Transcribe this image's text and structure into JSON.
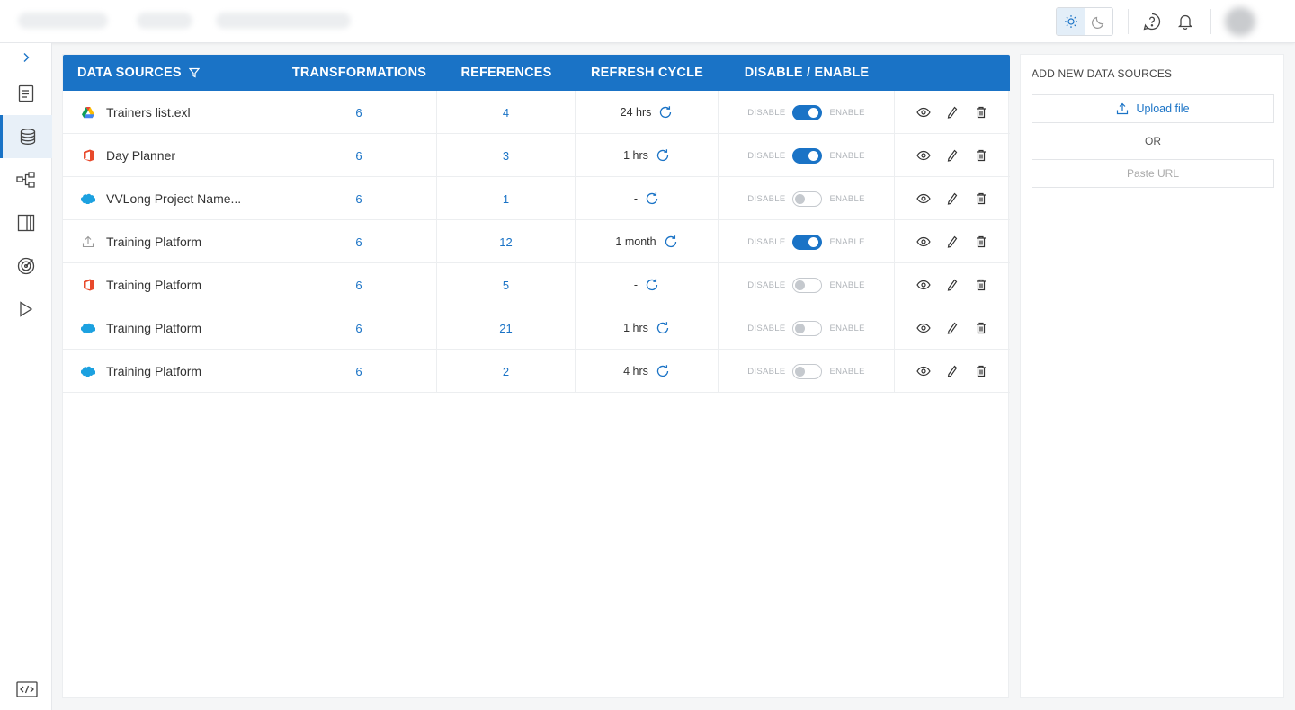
{
  "theme": {
    "accent": "#1a73c6"
  },
  "header": {
    "theme_modes": [
      "light-mode",
      "dark-mode"
    ],
    "active_theme": "light-mode"
  },
  "sidebar": {
    "items": [
      {
        "icon": "document-icon",
        "active": false
      },
      {
        "icon": "database-icon",
        "active": true
      },
      {
        "icon": "workflow-icon",
        "active": false
      },
      {
        "icon": "columns-icon",
        "active": false
      },
      {
        "icon": "target-icon",
        "active": false
      },
      {
        "icon": "play-icon",
        "active": false
      }
    ],
    "bottom_icon": "code-icon"
  },
  "table": {
    "headers": [
      "DATA SOURCES",
      "TRANSFORMATIONS",
      "REFERENCES",
      "REFRESH CYCLE",
      "DISABLE / ENABLE"
    ],
    "toggle_labels": {
      "off": "DISABLE",
      "on": "ENABLE"
    },
    "rows": [
      {
        "source_icon": "google-drive-icon",
        "name": "Trainers list.exl",
        "transformations": "6",
        "references": "4",
        "refresh_cycle": "24 hrs",
        "enabled": true
      },
      {
        "source_icon": "office-icon",
        "name": "Day Planner",
        "transformations": "6",
        "references": "3",
        "refresh_cycle": "1 hrs",
        "enabled": true
      },
      {
        "source_icon": "salesforce-icon",
        "name": "VVLong Project Name...",
        "transformations": "6",
        "references": "1",
        "refresh_cycle": "-",
        "enabled": false
      },
      {
        "source_icon": "upload-icon",
        "name": "Training Platform",
        "transformations": "6",
        "references": "12",
        "refresh_cycle": "1 month",
        "enabled": true
      },
      {
        "source_icon": "office-icon",
        "name": "Training Platform",
        "transformations": "6",
        "references": "5",
        "refresh_cycle": "-",
        "enabled": false
      },
      {
        "source_icon": "salesforce-icon",
        "name": "Training Platform",
        "transformations": "6",
        "references": "21",
        "refresh_cycle": "1 hrs",
        "enabled": false
      },
      {
        "source_icon": "salesforce-icon",
        "name": "Training Platform",
        "transformations": "6",
        "references": "2",
        "refresh_cycle": "4 hrs",
        "enabled": false
      }
    ]
  },
  "add_panel": {
    "title": "ADD NEW DATA SOURCES",
    "upload_label": "Upload file",
    "or_text": "OR",
    "url_placeholder": "Paste URL"
  }
}
